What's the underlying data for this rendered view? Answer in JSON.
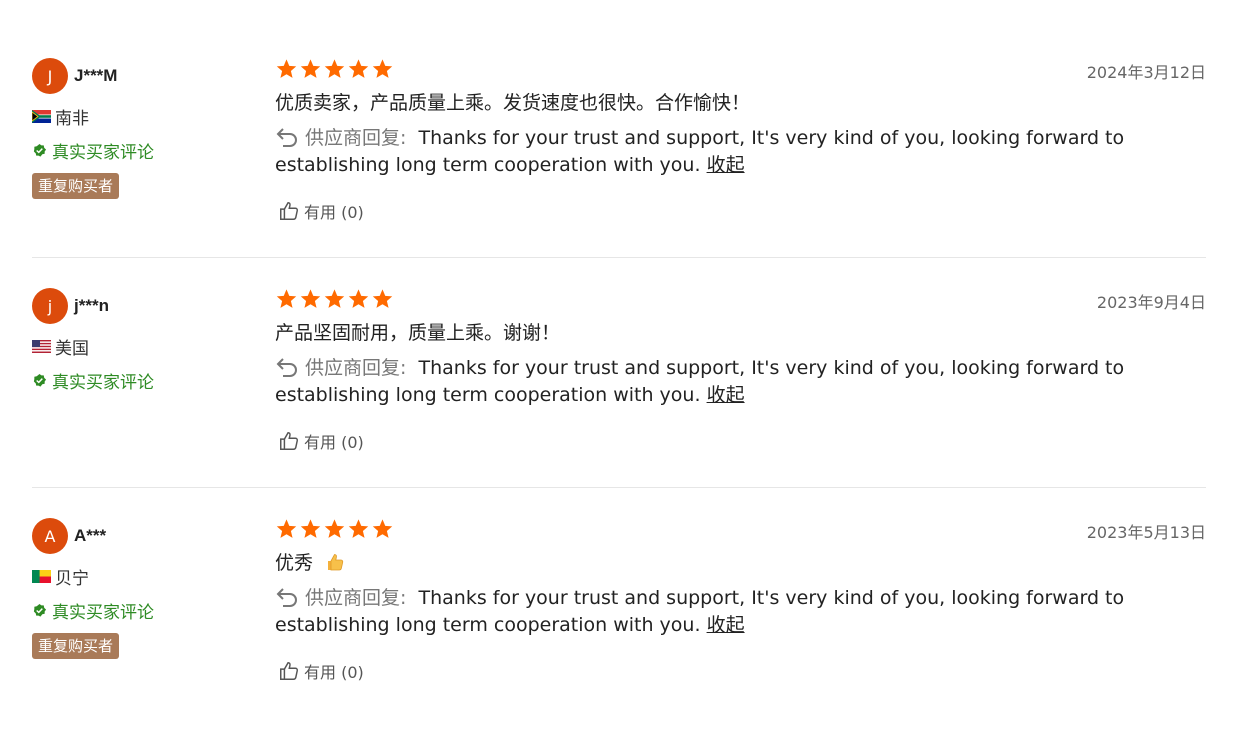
{
  "reply_label": "供应商回复:",
  "reply_text": "Thanks for your trust and support, It's very kind of you, looking forward to establishing long term cooperation with you.",
  "collapse_label": "收起",
  "verified_label": "真实买家评论",
  "repeat_label": "重复购买者",
  "helpful_label": "有用 (0)",
  "colors": {
    "star": "#ff6a00",
    "avatar": "#dc4b0c",
    "verified": "#2e8b24",
    "repeat_badge": "#a97a58"
  },
  "reviews": [
    {
      "initial": "J",
      "name": "J***M",
      "country": "南非",
      "flag": "south-africa-flag",
      "repeat_buyer": true,
      "rating": 5,
      "date": "2024年3月12日",
      "text": "优质卖家，产品质量上乘。发货速度也很快。合作愉快！"
    },
    {
      "initial": "j",
      "name": "j***n",
      "country": "美国",
      "flag": "usa-flag",
      "repeat_buyer": false,
      "rating": 5,
      "date": "2023年9月4日",
      "text": "产品坚固耐用，质量上乘。谢谢！"
    },
    {
      "initial": "A",
      "name": "A***",
      "country": "贝宁",
      "flag": "benin-flag",
      "repeat_buyer": true,
      "rating": 5,
      "date": "2023年5月13日",
      "text": "优秀"
    }
  ]
}
